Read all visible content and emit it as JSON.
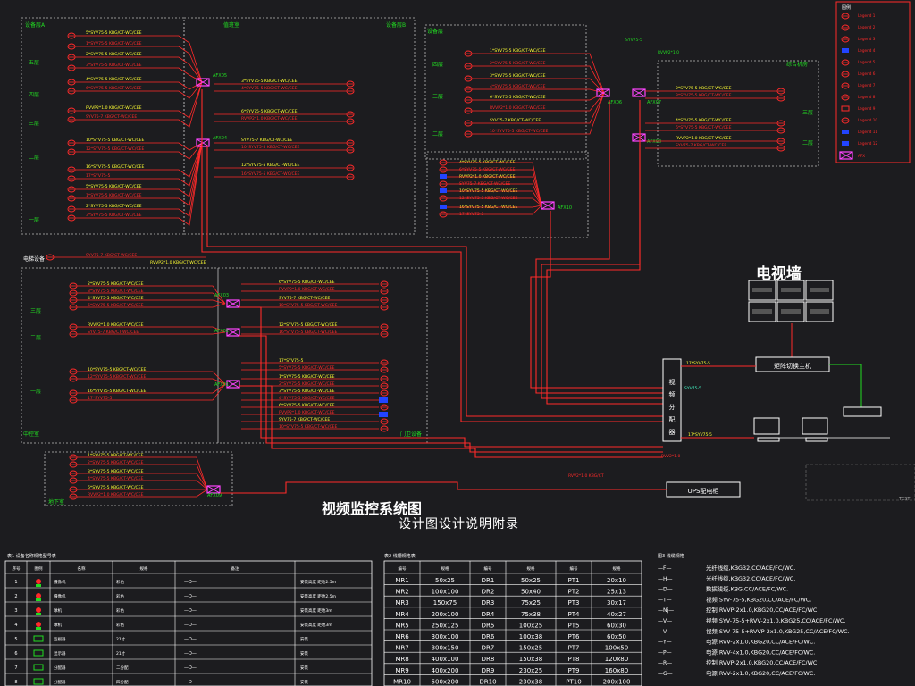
{
  "title": "视频监控系统图",
  "subtitle": "设计图设计说明附录",
  "video_wall": {
    "title": "电视墙",
    "matrix_label": "矩阵切换主机",
    "ups_label": "UPS配电柜"
  },
  "zone_labels": {
    "top_left": "设备层A",
    "top_mid": "值班室",
    "top_right": "设备层B",
    "right_a": "设备层",
    "right_b": "综合机房",
    "mid_left": "中控室",
    "bottom_right": "门卫设备",
    "basement": "地下室",
    "left_tags": "电梯设备"
  },
  "floors": [
    "五层",
    "四层",
    "三层",
    "二层",
    "一层"
  ],
  "boxes": [
    "AFX05",
    "AFX04",
    "AFX03",
    "AFX02",
    "AFX01",
    "AFX06",
    "AFX07",
    "AFX08",
    "AFX09",
    "AFX10"
  ],
  "cable_texts": [
    "5*SYV75-5 KBG/CT-WC/CEE",
    "1*SYV75-5 KBG/CT-WC/CEE",
    "2*SYV75-5 KBG/CT-WC/CEE",
    "3*SYV75-5 KBG/CT-WC/CEE",
    "4*SYV75-5 KBG/CT-WC/CEE",
    "6*SYV75-5 KBG/CT-WC/CEE",
    "RVVP2*1.0 KBG/CT-WC/CEE",
    "SYV75-7 KBG/CT-WC/CEE",
    "10*SYV75-5 KBG/CT-WC/CEE",
    "12*SYV75-5 KBG/CT-WC/CEE",
    "16*SYV75-5 KBG/CT-WC/CEE",
    "17*SYV75-5"
  ],
  "legend_panel": {
    "rows": [
      "Legend 1",
      "Legend 2",
      "Legend 3",
      "Legend 4",
      "Legend 5",
      "Legend 6",
      "Legend 7",
      "Legend 8",
      "Legend 9",
      "Legend 10",
      "Legend 11",
      "Legend 12"
    ]
  },
  "table1": {
    "caption": "表1 设备名称规格型号表",
    "headers": [
      "序号",
      "图例",
      "名称",
      "规格",
      "备注"
    ],
    "rows": [
      {
        "no": "1",
        "name": "摄像机",
        "spec": "彩色",
        "sym": "—D—",
        "note": "安装高度 距地2.5m"
      },
      {
        "no": "2",
        "name": "摄像机",
        "spec": "彩色",
        "sym": "—D—",
        "note": "安装高度 距地2.5m"
      },
      {
        "no": "3",
        "name": "球机",
        "spec": "彩色",
        "sym": "—D—",
        "note": "安装高度 距地3m"
      },
      {
        "no": "4",
        "name": "球机",
        "spec": "彩色",
        "sym": "—D—",
        "note": "安装高度 距地3m"
      },
      {
        "no": "5",
        "name": "监视器",
        "spec": "21寸",
        "sym": "—D—",
        "note": "安装"
      },
      {
        "no": "6",
        "name": "显示器",
        "spec": "21寸",
        "sym": "—D—",
        "note": "安装"
      },
      {
        "no": "7",
        "name": "分配器",
        "spec": "二分配",
        "sym": "—D—",
        "note": "安装"
      },
      {
        "no": "8",
        "name": "分配器",
        "spec": "四分配",
        "sym": "—D—",
        "note": "安装"
      }
    ]
  },
  "table2": {
    "caption": "表2 线槽规格表",
    "headers": [
      "编号",
      "规格",
      "编号",
      "规格",
      "编号",
      "规格"
    ],
    "rows": [
      [
        "MR1",
        "50x25",
        "DR1",
        "50x25",
        "PT1",
        "20x10"
      ],
      [
        "MR2",
        "100x100",
        "DR2",
        "50x40",
        "PT2",
        "25x13"
      ],
      [
        "MR3",
        "150x75",
        "DR3",
        "75x25",
        "PT3",
        "30x17"
      ],
      [
        "MR4",
        "200x100",
        "DR4",
        "75x38",
        "PT4",
        "40x27"
      ],
      [
        "MR5",
        "250x125",
        "DR5",
        "100x25",
        "PT5",
        "60x30"
      ],
      [
        "MR6",
        "300x100",
        "DR6",
        "100x38",
        "PT6",
        "60x50"
      ],
      [
        "MR7",
        "300x150",
        "DR7",
        "150x25",
        "PT7",
        "100x50"
      ],
      [
        "MR8",
        "400x100",
        "DR8",
        "150x38",
        "PT8",
        "120x80"
      ],
      [
        "MR9",
        "400x200",
        "DR9",
        "230x25",
        "PT9",
        "160x80"
      ],
      [
        "MR10",
        "500x200",
        "DR10",
        "230x38",
        "PT10",
        "200x100"
      ]
    ]
  },
  "wire_legend": {
    "caption": "图3 线缆规格",
    "rows": [
      {
        "sym": "—F—",
        "text": "光纤线缆,KBG32,CC/ACE/FC/WC."
      },
      {
        "sym": "—H—",
        "text": "光纤线缆,KBG32,CC/ACE/FC/WC."
      },
      {
        "sym": "—D—",
        "text": "数据线缆,KBG,CC/ACE/FC/WC."
      },
      {
        "sym": "—T—",
        "text": "视频 SYV-75-5,KBG20,CC/ACE/FC/WC."
      },
      {
        "sym": "—Nj—",
        "text": "控制 RVVP-2x1.0,KBG20,CC/ACE/FC/WC."
      },
      {
        "sym": "—V—",
        "text": "视频 SYV-75-5+RVV-2x1.0,KBG25,CC/ACE/FC/WC."
      },
      {
        "sym": "—V—",
        "text": "视频 SYV-75-5+RVVP-2x1.0,KBG25,CC/ACE/FC/WC."
      },
      {
        "sym": "—Y—",
        "text": "电源 RVV-2x1.0,KBG20,CC/ACE/FC/WC."
      },
      {
        "sym": "—P—",
        "text": "电源 RVV-4x1.0,KBG20,CC/ACE/FC/WC."
      },
      {
        "sym": "—R—",
        "text": "控制 RVVP-2x1.0,KBG20,CC/ACE/FC/WC."
      },
      {
        "sym": "—G—",
        "text": "电源 RVV-2x1.0,KBG20,CC/ACE/FC/WC."
      }
    ]
  },
  "colors": {
    "bg": "#1c1c1f",
    "red": "#ff2a2a",
    "yellow": "#ffff33",
    "white": "#ffffff",
    "green": "#22dd22",
    "magenta": "#ff44ff",
    "blue": "#2244ff",
    "cyan": "#44ffcc"
  }
}
